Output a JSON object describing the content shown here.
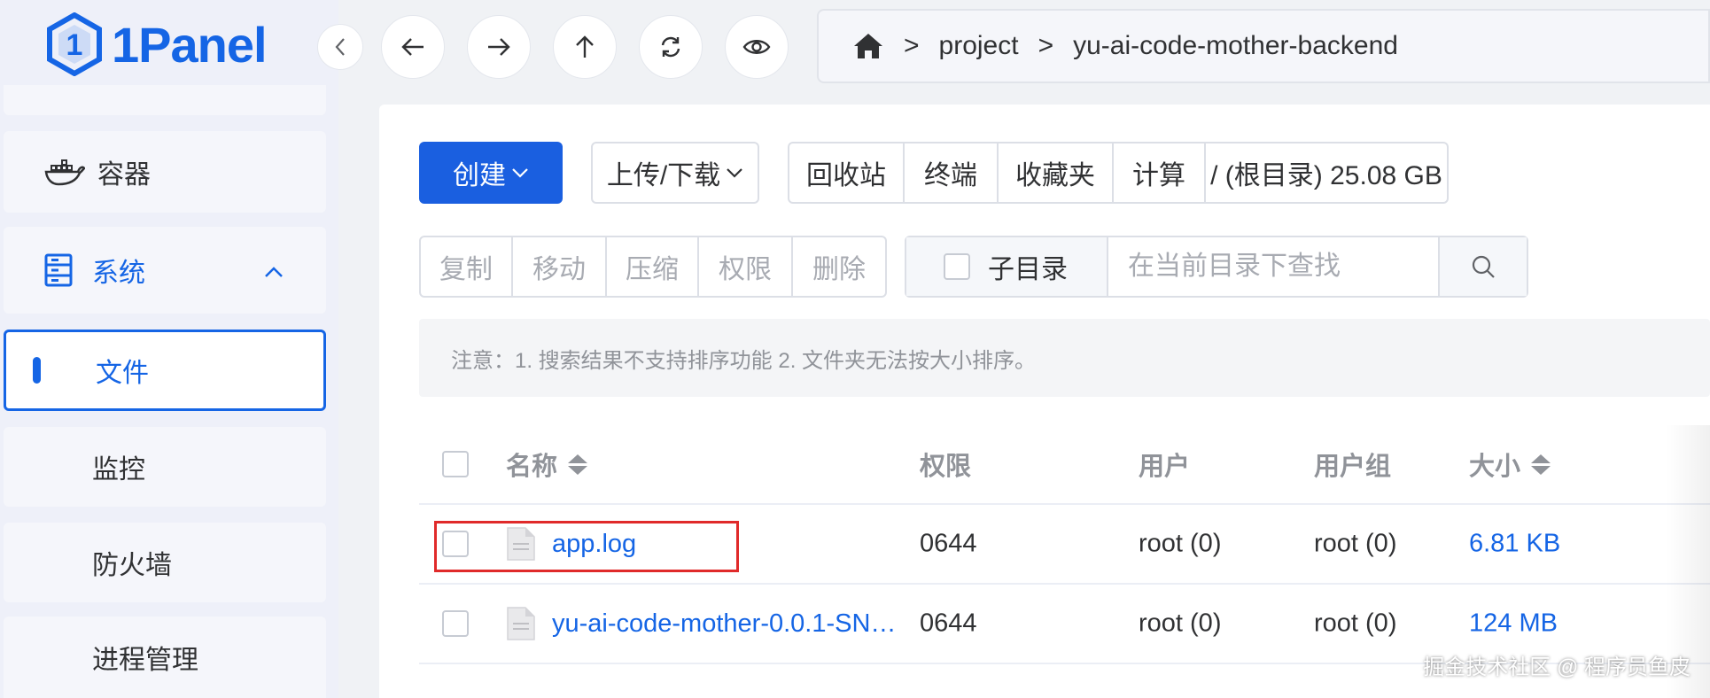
{
  "brand": {
    "name": "1Panel",
    "accent": "#1565e5"
  },
  "sidebar": {
    "items": [
      {
        "label": "容器",
        "icon": "docker-icon"
      },
      {
        "label": "系统",
        "icon": "server-icon",
        "expanded": true
      },
      {
        "label": "文件",
        "active": true
      },
      {
        "label": "监控"
      },
      {
        "label": "防火墙"
      },
      {
        "label": "进程管理"
      }
    ]
  },
  "breadcrumb": {
    "items": [
      "project",
      "yu-ai-code-mother-backend"
    ],
    "separator": ">"
  },
  "toolbar": {
    "create_label": "创建",
    "upload_label": "上传/下载",
    "recycle_label": "回收站",
    "terminal_label": "终端",
    "favorites_label": "收藏夹",
    "calc_label": "计算",
    "disk_label": "/ (根目录) 25.08 GB",
    "copy_label": "复制",
    "move_label": "移动",
    "compress_label": "压缩",
    "permission_label": "权限",
    "delete_label": "删除",
    "subdir_label": "子目录",
    "search_placeholder": "在当前目录下查找"
  },
  "notice": "注意：1. 搜索结果不支持排序功能 2. 文件夹无法按大小排序。",
  "table": {
    "headers": {
      "name": "名称",
      "perm": "权限",
      "user": "用户",
      "group": "用户组",
      "size": "大小"
    },
    "rows": [
      {
        "name": "app.log",
        "perm": "0644",
        "user": "root (0)",
        "group": "root (0)",
        "size": "6.81 KB"
      },
      {
        "name": "yu-ai-code-mother-0.0.1-SN…",
        "perm": "0644",
        "user": "root (0)",
        "group": "root (0)",
        "size": "124 MB"
      }
    ]
  },
  "watermark": "掘金技术社区 @ 程序员鱼皮"
}
